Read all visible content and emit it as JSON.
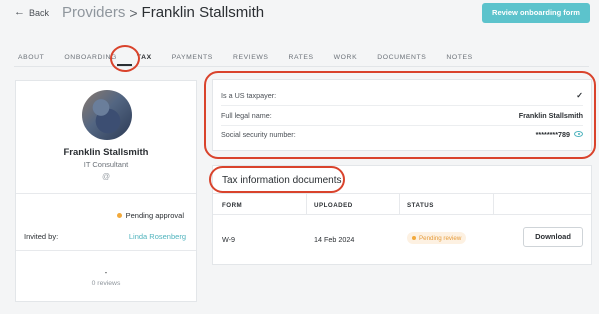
{
  "header": {
    "back_label": "Back",
    "breadcrumb_parent": "Providers",
    "breadcrumb_separator": ">",
    "breadcrumb_current": "Franklin Stallsmith",
    "review_button": "Review onboarding form"
  },
  "tabs": [
    {
      "label": "ABOUT",
      "active": false
    },
    {
      "label": "ONBOARDING",
      "active": false
    },
    {
      "label": "TAX",
      "active": true
    },
    {
      "label": "PAYMENTS",
      "active": false
    },
    {
      "label": "REVIEWS",
      "active": false
    },
    {
      "label": "RATES",
      "active": false
    },
    {
      "label": "WORK",
      "active": false
    },
    {
      "label": "DOCUMENTS",
      "active": false
    },
    {
      "label": "NOTES",
      "active": false
    }
  ],
  "profile": {
    "name": "Franklin Stallsmith",
    "role": "IT Consultant",
    "at_symbol": "@",
    "status": "Pending approval",
    "invited_label": "Invited by:",
    "invited_by": "Linda Rosenberg",
    "rating": "-",
    "reviews": "0 reviews"
  },
  "tax_info": {
    "us_taxpayer_label": "Is a US taxpayer:",
    "us_taxpayer_value": "✓",
    "legal_name_label": "Full legal name:",
    "legal_name_value": "Franklin Stallsmith",
    "ssn_label": "Social security number:",
    "ssn_value": "********789"
  },
  "documents": {
    "title": "Tax information documents",
    "columns": {
      "form": "FORM",
      "uploaded": "UPLOADED",
      "status": "STATUS"
    },
    "rows": [
      {
        "form": "W-9",
        "uploaded": "14 Feb 2024",
        "status": "Pending review",
        "action": "Download"
      }
    ]
  },
  "colors": {
    "accent": "#5cc3cc",
    "link": "#4fb3bd",
    "pending": "#f2a93b",
    "annotation": "#d9432c"
  }
}
